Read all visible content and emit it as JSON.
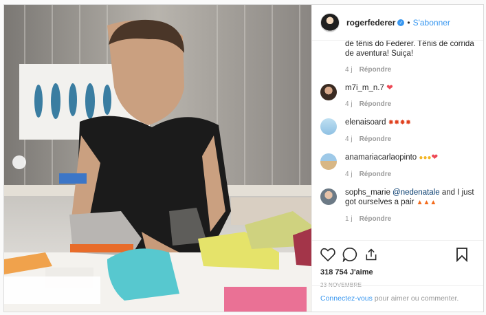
{
  "post": {
    "username": "rogerfederer",
    "follow_label": "S'abonner",
    "separator": "•",
    "likes_count": "318 754",
    "likes_label": "J'aime",
    "date": "23 NOVEMBRE",
    "login_link": "Connectez-vous",
    "login_text": " pour aimer ou commenter."
  },
  "comments": [
    {
      "user": "",
      "text": "de tênis do Federer. Tênis de corrida de aventura! Suiça!",
      "age": "4 j",
      "reply": "Répondre",
      "emojis": []
    },
    {
      "user": "m7i_m_n.7",
      "text": "",
      "age": "4 j",
      "reply": "Répondre",
      "emojis": [
        "heart"
      ]
    },
    {
      "user": "elenaisoard",
      "text": "",
      "age": "4 j",
      "reply": "Répondre",
      "emojis": [
        "collision",
        "collision",
        "collision",
        "collision"
      ]
    },
    {
      "user": "anamariacarlaopinto",
      "text": "",
      "age": "4 j",
      "reply": "Répondre",
      "emojis": [
        "clap",
        "clap",
        "clap",
        "heart"
      ]
    },
    {
      "user": "sophs_marie",
      "mention": "@nedenatale",
      "text": "and I just got ourselves a pair",
      "age": "1 j",
      "reply": "Répondre",
      "emojis": [
        "fire",
        "fire",
        "fire"
      ]
    }
  ],
  "colors": {
    "link": "#3897f0",
    "heart": "#ed4956"
  },
  "icons": [
    "heart-icon",
    "comment-icon",
    "share-icon",
    "bookmark-icon"
  ]
}
